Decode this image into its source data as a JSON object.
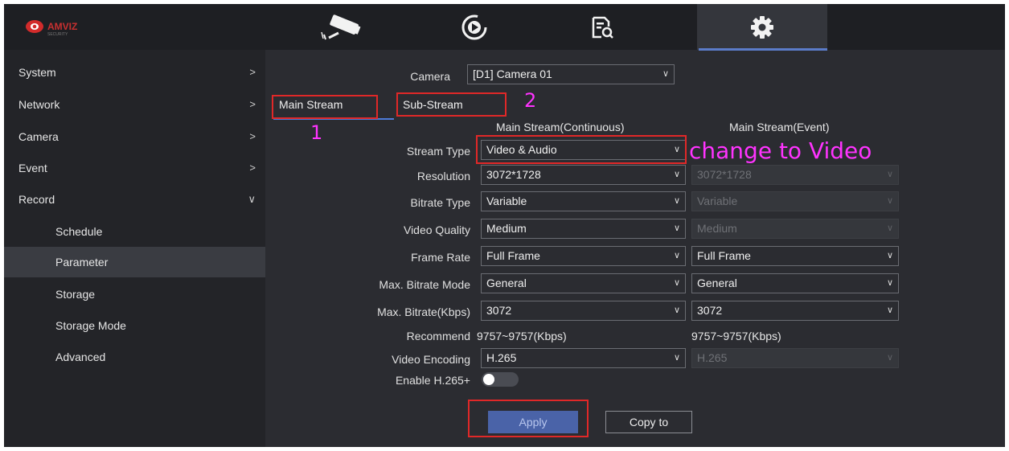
{
  "logo": {
    "text": "AMVIZ",
    "sub": "SECURITY"
  },
  "top_tabs": [
    {
      "name": "live-view",
      "icon": "camera-icon"
    },
    {
      "name": "playback",
      "icon": "playback-icon"
    },
    {
      "name": "search",
      "icon": "file-search-icon"
    },
    {
      "name": "settings",
      "icon": "gear-icon",
      "active": true
    }
  ],
  "sidebar": {
    "items": [
      {
        "label": "System",
        "chevron": ">"
      },
      {
        "label": "Network",
        "chevron": ">"
      },
      {
        "label": "Camera",
        "chevron": ">"
      },
      {
        "label": "Event",
        "chevron": ">"
      },
      {
        "label": "Record",
        "chevron": "∨"
      },
      {
        "label": "Schedule"
      },
      {
        "label": "Parameter",
        "active": true
      },
      {
        "label": "Storage"
      },
      {
        "label": "Storage Mode"
      },
      {
        "label": "Advanced"
      }
    ]
  },
  "camera": {
    "label": "Camera",
    "value": "[D1] Camera 01"
  },
  "tabs": {
    "main": "Main Stream",
    "sub": "Sub-Stream"
  },
  "columns": {
    "continuous": "Main Stream(Continuous)",
    "event": "Main Stream(Event)"
  },
  "fields": {
    "stream_type": {
      "label": "Stream Type",
      "cont": "Video & Audio"
    },
    "resolution": {
      "label": "Resolution",
      "cont": "3072*1728",
      "event": "3072*1728"
    },
    "bitrate_type": {
      "label": "Bitrate Type",
      "cont": "Variable",
      "event": "Variable"
    },
    "video_quality": {
      "label": "Video Quality",
      "cont": "Medium",
      "event": "Medium"
    },
    "frame_rate": {
      "label": "Frame Rate",
      "cont": "Full Frame",
      "event": "Full Frame"
    },
    "max_bitrate_mode": {
      "label": "Max. Bitrate Mode",
      "cont": "General",
      "event": "General"
    },
    "max_bitrate": {
      "label": "Max. Bitrate(Kbps)",
      "cont": "3072",
      "event": "3072"
    },
    "recommend": {
      "label": "Recommend",
      "cont": "9757~9757(Kbps)",
      "event": "9757~9757(Kbps)"
    },
    "video_encoding": {
      "label": "Video Encoding",
      "cont": "H.265",
      "event": "H.265"
    },
    "enable_h265plus": {
      "label": "Enable H.265+"
    }
  },
  "buttons": {
    "apply": "Apply",
    "copy": "Copy to"
  },
  "annotations": {
    "one": "1",
    "two": "2",
    "change": "change to Video"
  },
  "colors": {
    "accent": "#4d7bd8",
    "annotation_box": "#e02828",
    "annotation_text": "#ff33ff"
  }
}
